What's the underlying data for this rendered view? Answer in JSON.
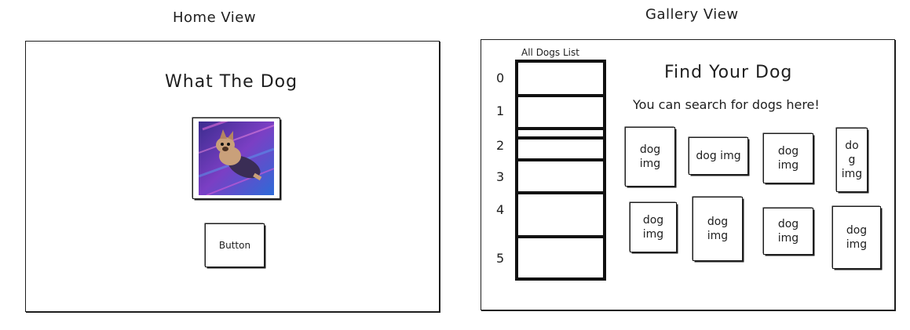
{
  "home_view": {
    "view_title": "Home View",
    "title": "What The Dog",
    "image_alt": "dog photo",
    "button_label": "Button"
  },
  "gallery_view": {
    "view_title": "Gallery View",
    "list_label": "All Dogs List",
    "list_rows": [
      "0",
      "1",
      "2",
      "3",
      "4",
      "5"
    ],
    "title": "Find Your Dog",
    "subtitle": "You can search for dogs here!",
    "cards": [
      "dog\nimg",
      "dog img",
      "dog\nimg",
      "do\ng\nimg",
      "dog\nimg",
      "dog\nimg",
      "dog\nimg",
      "dog\nimg"
    ]
  },
  "colors": {
    "ink": "#1e1e1e",
    "photo_bg_start": "#3a2a8a",
    "photo_bg_end": "#c04fd8"
  }
}
